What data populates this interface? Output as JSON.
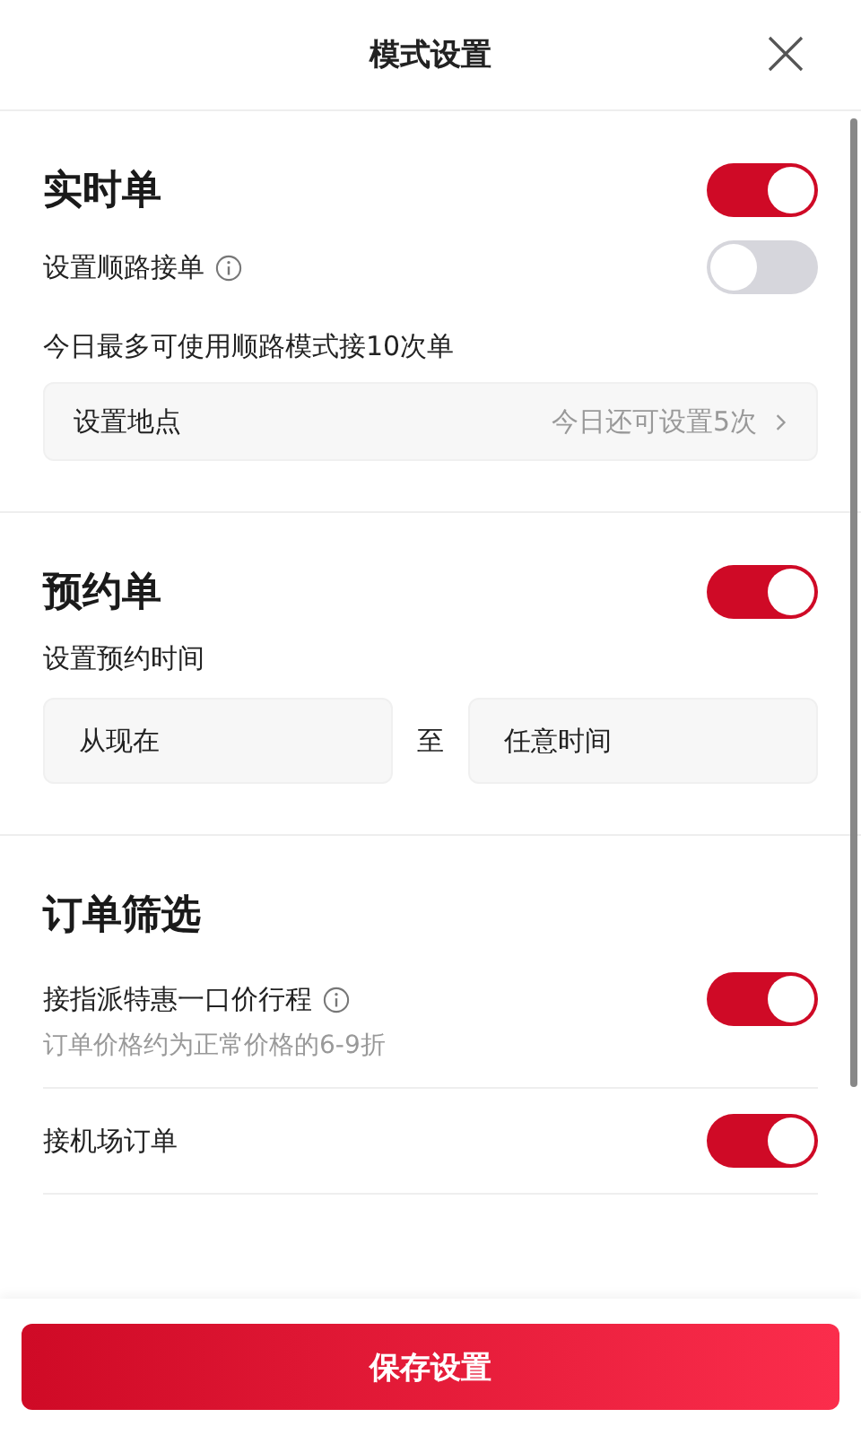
{
  "header": {
    "title": "模式设置"
  },
  "sections": [
    {
      "title": "实时单",
      "on": true,
      "items": [
        {
          "kind": "toggle",
          "label": "设置顺路接单",
          "info": true,
          "on": false
        },
        {
          "kind": "note",
          "text": "今日最多可使用顺路模式接10次单"
        },
        {
          "kind": "link",
          "label": "设置地点",
          "value": "今日还可设置5次"
        }
      ]
    },
    {
      "title": "预约单",
      "on": true,
      "items": [
        {
          "kind": "note",
          "text": "设置预约时间"
        },
        {
          "kind": "range",
          "from": "从现在",
          "separator": "至",
          "to": "任意时间"
        }
      ]
    },
    {
      "title": "订单筛选",
      "items": [
        {
          "kind": "toggle",
          "label": "接指派特惠一口价行程",
          "info": true,
          "on": true,
          "hint": "订单价格约为正常价格的6-9折"
        },
        {
          "kind": "toggle",
          "label": "接机场订单",
          "on": true
        }
      ]
    }
  ],
  "save_button": "保存设置"
}
